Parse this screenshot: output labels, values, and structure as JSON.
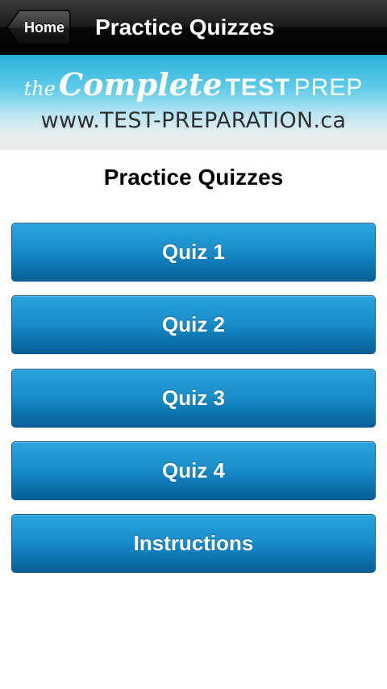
{
  "navbar": {
    "back_label": "Home",
    "title": "Practice Quizzes"
  },
  "banner": {
    "logo_the": "the",
    "logo_complete": "Complete",
    "logo_test": "TEST",
    "logo_prep": "PREP",
    "url": "www.TEST-PREPARATION.ca"
  },
  "main": {
    "heading": "Practice Quizzes",
    "buttons": [
      {
        "label": "Quiz 1"
      },
      {
        "label": "Quiz 2"
      },
      {
        "label": "Quiz 3"
      },
      {
        "label": "Quiz 4"
      },
      {
        "label": "Instructions"
      }
    ]
  },
  "colors": {
    "navbar": "#000000",
    "banner_top": "#28b1d9",
    "banner_bottom": "#e9ecee",
    "button": "#1a8fcb",
    "button_text": "#ffffff"
  }
}
